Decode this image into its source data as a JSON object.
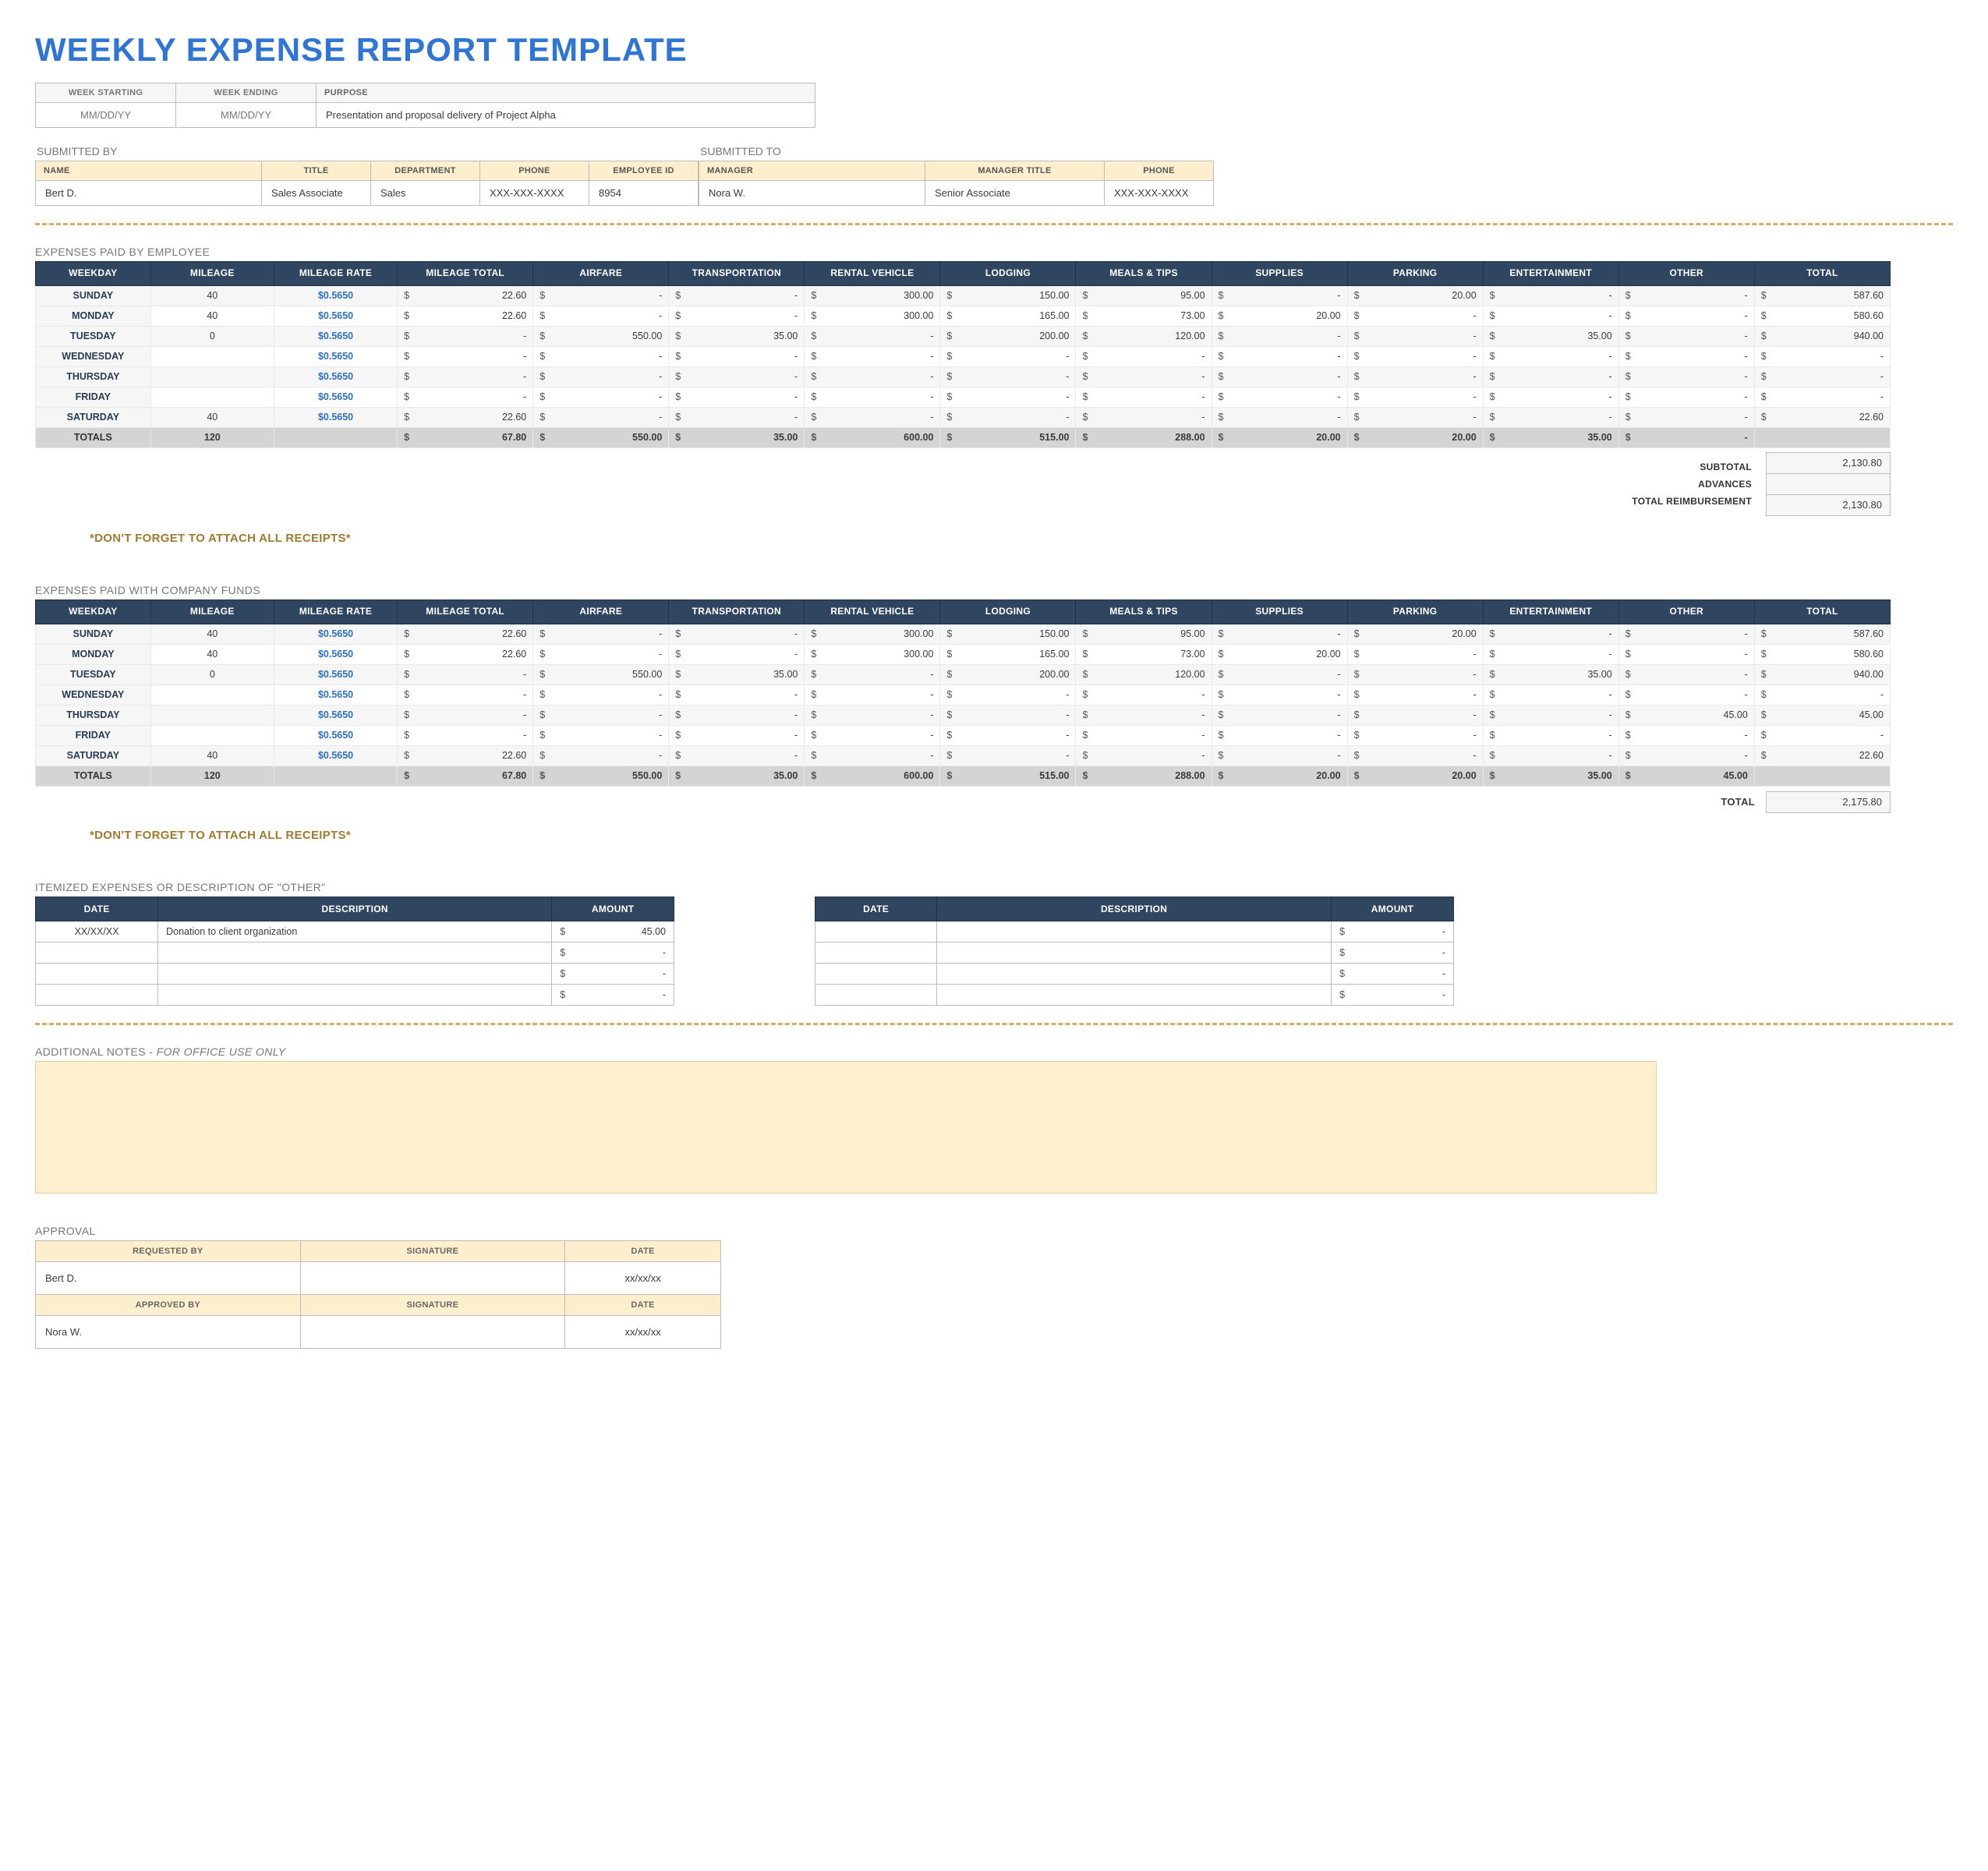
{
  "title": "WEEKLY EXPENSE REPORT TEMPLATE",
  "period": {
    "hdr_start": "WEEK STARTING",
    "hdr_end": "WEEK ENDING",
    "hdr_purpose": "PURPOSE",
    "start": "MM/DD/YY",
    "end": "MM/DD/YY",
    "purpose": "Presentation and proposal delivery of Project Alpha"
  },
  "submitted_by": {
    "label": "SUBMITTED BY",
    "hdr": {
      "name": "NAME",
      "title": "TITLE",
      "dept": "DEPARTMENT",
      "phone": "PHONE",
      "emp": "EMPLOYEE ID"
    },
    "val": {
      "name": "Bert D.",
      "title": "Sales Associate",
      "dept": "Sales",
      "phone": "XXX-XXX-XXXX",
      "emp": "8954"
    }
  },
  "submitted_to": {
    "label": "SUBMITTED TO",
    "hdr": {
      "manager": "MANAGER",
      "mtitle": "MANAGER TITLE",
      "phone": "PHONE"
    },
    "val": {
      "manager": "Nora W.",
      "mtitle": "Senior Associate",
      "phone": "XXX-XXX-XXXX"
    }
  },
  "expense_headers": [
    "WEEKDAY",
    "MILEAGE",
    "MILEAGE RATE",
    "MILEAGE TOTAL",
    "AIRFARE",
    "TRANSPORTATION",
    "RENTAL VEHICLE",
    "LODGING",
    "MEALS & TIPS",
    "SUPPLIES",
    "PARKING",
    "ENTERTAINMENT",
    "OTHER",
    "TOTAL"
  ],
  "sec1": {
    "label": "EXPENSES PAID BY EMPLOYEE",
    "rows": [
      {
        "day": "SUNDAY",
        "mileage": "40",
        "rate": "$0.5650",
        "mt": "22.60",
        "air": "-",
        "trans": "-",
        "rental": "300.00",
        "lodg": "150.00",
        "meals": "95.00",
        "sup": "-",
        "park": "20.00",
        "ent": "-",
        "other": "-",
        "total": "587.60"
      },
      {
        "day": "MONDAY",
        "mileage": "40",
        "rate": "$0.5650",
        "mt": "22.60",
        "air": "-",
        "trans": "-",
        "rental": "300.00",
        "lodg": "165.00",
        "meals": "73.00",
        "sup": "20.00",
        "park": "-",
        "ent": "-",
        "other": "-",
        "total": "580.60"
      },
      {
        "day": "TUESDAY",
        "mileage": "0",
        "rate": "$0.5650",
        "mt": "-",
        "air": "550.00",
        "trans": "35.00",
        "rental": "-",
        "lodg": "200.00",
        "meals": "120.00",
        "sup": "-",
        "park": "-",
        "ent": "35.00",
        "other": "-",
        "total": "940.00"
      },
      {
        "day": "WEDNESDAY",
        "mileage": "",
        "rate": "$0.5650",
        "mt": "-",
        "air": "-",
        "trans": "-",
        "rental": "-",
        "lodg": "-",
        "meals": "-",
        "sup": "-",
        "park": "-",
        "ent": "-",
        "other": "-",
        "total": "-"
      },
      {
        "day": "THURSDAY",
        "mileage": "",
        "rate": "$0.5650",
        "mt": "-",
        "air": "-",
        "trans": "-",
        "rental": "-",
        "lodg": "-",
        "meals": "-",
        "sup": "-",
        "park": "-",
        "ent": "-",
        "other": "-",
        "total": "-"
      },
      {
        "day": "FRIDAY",
        "mileage": "",
        "rate": "$0.5650",
        "mt": "-",
        "air": "-",
        "trans": "-",
        "rental": "-",
        "lodg": "-",
        "meals": "-",
        "sup": "-",
        "park": "-",
        "ent": "-",
        "other": "-",
        "total": "-"
      },
      {
        "day": "SATURDAY",
        "mileage": "40",
        "rate": "$0.5650",
        "mt": "22.60",
        "air": "-",
        "trans": "-",
        "rental": "-",
        "lodg": "-",
        "meals": "-",
        "sup": "-",
        "park": "-",
        "ent": "-",
        "other": "-",
        "total": "22.60"
      }
    ],
    "totals": {
      "day": "TOTALS",
      "mileage": "120",
      "rate": "",
      "mt": "67.80",
      "air": "550.00",
      "trans": "35.00",
      "rental": "600.00",
      "lodg": "515.00",
      "meals": "288.00",
      "sup": "20.00",
      "park": "20.00",
      "ent": "35.00",
      "other": "-",
      "total": ""
    },
    "summary": {
      "subtotal_lbl": "SUBTOTAL",
      "advances_lbl": "ADVANCES",
      "reimb_lbl": "TOTAL REIMBURSEMENT",
      "subtotal": "2,130.80",
      "advances": "",
      "reimb": "2,130.80"
    },
    "reminder": "*DON'T FORGET TO ATTACH ALL RECEIPTS*"
  },
  "sec2": {
    "label": "EXPENSES PAID WITH COMPANY FUNDS",
    "rows": [
      {
        "day": "SUNDAY",
        "mileage": "40",
        "rate": "$0.5650",
        "mt": "22.60",
        "air": "-",
        "trans": "-",
        "rental": "300.00",
        "lodg": "150.00",
        "meals": "95.00",
        "sup": "-",
        "park": "20.00",
        "ent": "-",
        "other": "-",
        "total": "587.60"
      },
      {
        "day": "MONDAY",
        "mileage": "40",
        "rate": "$0.5650",
        "mt": "22.60",
        "air": "-",
        "trans": "-",
        "rental": "300.00",
        "lodg": "165.00",
        "meals": "73.00",
        "sup": "20.00",
        "park": "-",
        "ent": "-",
        "other": "-",
        "total": "580.60"
      },
      {
        "day": "TUESDAY",
        "mileage": "0",
        "rate": "$0.5650",
        "mt": "-",
        "air": "550.00",
        "trans": "35.00",
        "rental": "-",
        "lodg": "200.00",
        "meals": "120.00",
        "sup": "-",
        "park": "-",
        "ent": "35.00",
        "other": "-",
        "total": "940.00"
      },
      {
        "day": "WEDNESDAY",
        "mileage": "",
        "rate": "$0.5650",
        "mt": "-",
        "air": "-",
        "trans": "-",
        "rental": "-",
        "lodg": "-",
        "meals": "-",
        "sup": "-",
        "park": "-",
        "ent": "-",
        "other": "-",
        "total": "-"
      },
      {
        "day": "THURSDAY",
        "mileage": "",
        "rate": "$0.5650",
        "mt": "-",
        "air": "-",
        "trans": "-",
        "rental": "-",
        "lodg": "-",
        "meals": "-",
        "sup": "-",
        "park": "-",
        "ent": "-",
        "other": "45.00",
        "total": "45.00"
      },
      {
        "day": "FRIDAY",
        "mileage": "",
        "rate": "$0.5650",
        "mt": "-",
        "air": "-",
        "trans": "-",
        "rental": "-",
        "lodg": "-",
        "meals": "-",
        "sup": "-",
        "park": "-",
        "ent": "-",
        "other": "-",
        "total": "-"
      },
      {
        "day": "SATURDAY",
        "mileage": "40",
        "rate": "$0.5650",
        "mt": "22.60",
        "air": "-",
        "trans": "-",
        "rental": "-",
        "lodg": "-",
        "meals": "-",
        "sup": "-",
        "park": "-",
        "ent": "-",
        "other": "-",
        "total": "22.60"
      }
    ],
    "totals": {
      "day": "TOTALS",
      "mileage": "120",
      "rate": "",
      "mt": "67.80",
      "air": "550.00",
      "trans": "35.00",
      "rental": "600.00",
      "lodg": "515.00",
      "meals": "288.00",
      "sup": "20.00",
      "park": "20.00",
      "ent": "35.00",
      "other": "45.00",
      "total": ""
    },
    "total_lbl": "TOTAL",
    "total_val": "2,175.80",
    "reminder": "*DON'T FORGET TO ATTACH ALL RECEIPTS*"
  },
  "itemized": {
    "label": "ITEMIZED EXPENSES OR DESCRIPTION OF \"OTHER\"",
    "hdr": {
      "date": "DATE",
      "desc": "DESCRIPTION",
      "amt": "AMOUNT"
    },
    "left": [
      {
        "date": "XX/XX/XX",
        "desc": "Donation to client organization",
        "amt": "45.00"
      },
      {
        "date": "",
        "desc": "",
        "amt": "-"
      },
      {
        "date": "",
        "desc": "",
        "amt": "-"
      },
      {
        "date": "",
        "desc": "",
        "amt": "-"
      }
    ],
    "right": [
      {
        "date": "",
        "desc": "",
        "amt": "-"
      },
      {
        "date": "",
        "desc": "",
        "amt": "-"
      },
      {
        "date": "",
        "desc": "",
        "amt": "-"
      },
      {
        "date": "",
        "desc": "",
        "amt": "-"
      }
    ]
  },
  "notes": {
    "label_a": "ADDITIONAL NOTES - ",
    "label_b": "FOR OFFICE USE ONLY"
  },
  "approval": {
    "label": "APPROVAL",
    "hdr": {
      "req": "REQUESTED BY",
      "sig": "SIGNATURE",
      "date": "DATE",
      "appr": "APPROVED BY"
    },
    "req_name": "Bert D.",
    "req_date": "xx/xx/xx",
    "appr_name": "Nora W.",
    "appr_date": "xx/xx/xx"
  }
}
